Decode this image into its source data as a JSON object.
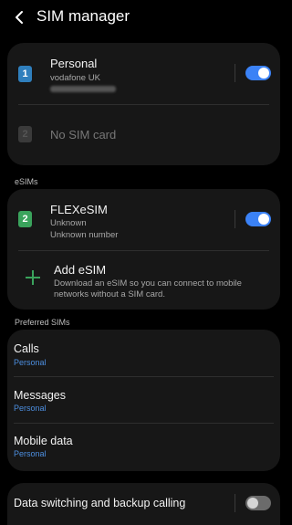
{
  "header": {
    "title": "SIM manager"
  },
  "sims": [
    {
      "slot": "1",
      "name": "Personal",
      "carrier": "vodafone UK",
      "enabled": true
    },
    {
      "slot": "2",
      "name": "No SIM card"
    }
  ],
  "esims_label": "eSIMs",
  "esim": {
    "slot": "2",
    "name": "FLEXeSIM",
    "line1": "Unknown",
    "line2": "Unknown number",
    "enabled": true
  },
  "add_esim": {
    "title": "Add eSIM",
    "description": "Download an eSIM so you can connect to mobile networks without a SIM card."
  },
  "preferred_label": "Preferred SIMs",
  "preferred": [
    {
      "title": "Calls",
      "value": "Personal"
    },
    {
      "title": "Messages",
      "value": "Personal"
    },
    {
      "title": "Mobile data",
      "value": "Personal"
    }
  ],
  "data_switching": {
    "title": "Data switching and backup calling",
    "enabled": false
  },
  "colors": {
    "accent": "#3b82f6",
    "esim_green": "#3aa35c",
    "sim_blue": "#2f7fbd",
    "link_blue": "#4d8fe0"
  }
}
